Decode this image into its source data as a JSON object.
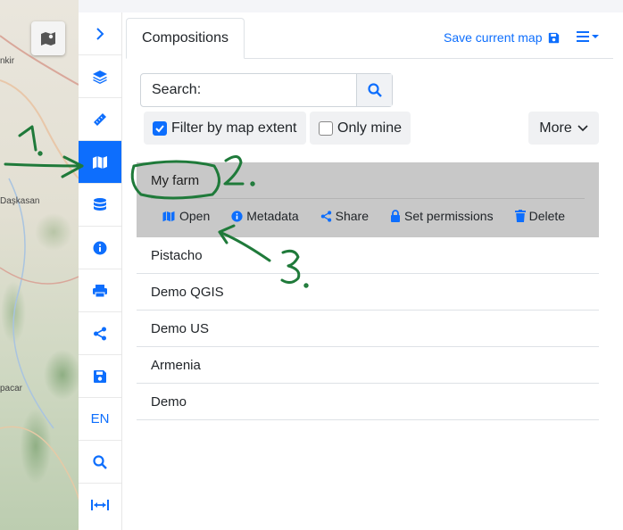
{
  "map": {
    "places": [
      "nkir",
      "Daşkasan",
      "pacar"
    ],
    "map_button_icon": "map-gallery-icon"
  },
  "toolbar": {
    "items": [
      {
        "icon": "chevron-right-icon"
      },
      {
        "icon": "layers-icon"
      },
      {
        "icon": "ruler-icon"
      },
      {
        "icon": "map-icon",
        "active": true
      },
      {
        "icon": "database-icon"
      },
      {
        "icon": "info-icon"
      },
      {
        "icon": "print-icon"
      },
      {
        "icon": "share-icon"
      },
      {
        "icon": "save-icon"
      },
      {
        "label": "EN"
      },
      {
        "icon": "search-icon"
      },
      {
        "icon": "expand-width-icon"
      }
    ]
  },
  "panel": {
    "tab_label": "Compositions",
    "save_label": "Save current map",
    "search_placeholder": "Search:",
    "filter_label": "Filter by map extent",
    "filter_checked": true,
    "only_mine_label": "Only mine",
    "only_mine_checked": false,
    "more_label": "More",
    "selected": {
      "name": "My farm",
      "actions": [
        "Open",
        "Metadata",
        "Share",
        "Set permissions",
        "Delete"
      ]
    },
    "items": [
      "Pistacho",
      "Demo QGIS",
      "Demo US",
      "Armenia",
      "Demo"
    ]
  },
  "colors": {
    "accent": "#0d6efd",
    "annotation": "#1f7a3a",
    "selected_bg": "#c8c8c8"
  }
}
